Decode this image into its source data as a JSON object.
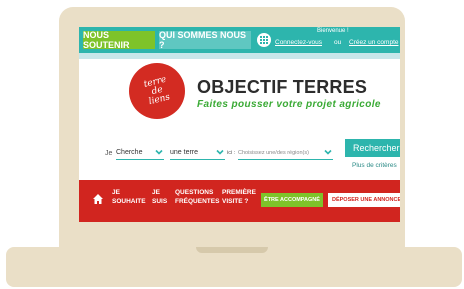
{
  "topbar": {
    "support_label": "NOUS SOUTENIR",
    "who_label": "QUI SOMMES NOUS ?",
    "welcome": "Bienvenue !",
    "connect_link": "Connectez-vous",
    "or_text": "ou",
    "create_link": "Créez un compte"
  },
  "header": {
    "logo_text_line1": "terre",
    "logo_text_line2": "de",
    "logo_text_line3": "liens",
    "title": "OBJECTIF TERRES",
    "tagline": "Faites pousser votre projet agricole"
  },
  "search": {
    "je_label": "Je",
    "select_action": "Cherche",
    "select_object": "une terre",
    "ici_label": "ici :",
    "select_region_placeholder": "Choisissez une/des région(s)",
    "search_button": "Rechercher",
    "more_criteria": "Plus de critères"
  },
  "nav": {
    "item1_line1": "JE",
    "item1_line2": "SOUHAITE",
    "item2_line1": "JE",
    "item2_line2": "SUIS",
    "item3_line1": "QUESTIONS",
    "item3_line2": "FRÉQUENTES",
    "item4_line1": "PREMIÈRE",
    "item4_line2": "VISITE ?",
    "accompanied_button": "ÊTRE ACCOMPAGNÉ",
    "post_ad_button": "DÉPOSER UNE ANNONCE"
  },
  "colors": {
    "teal": "#2db5ad",
    "green": "#7ec32a",
    "red": "#d1251f",
    "laptop": "#eadfc7"
  },
  "icons": [
    "grid-icon",
    "chevron-down-icon",
    "home-icon"
  ]
}
